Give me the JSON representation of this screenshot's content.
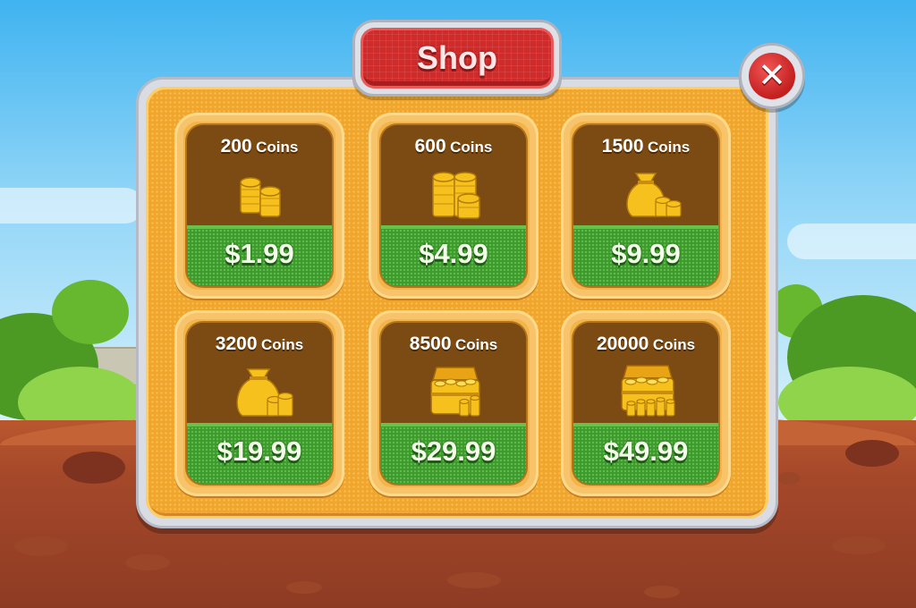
{
  "shop": {
    "title": "Shop",
    "close_icon": "close-x-icon",
    "items": [
      {
        "amount": "200",
        "unit": "Coins",
        "price": "$1.99",
        "icon": "coin-stack-small-icon"
      },
      {
        "amount": "600",
        "unit": "Coins",
        "price": "$4.99",
        "icon": "coin-stack-large-icon"
      },
      {
        "amount": "1500",
        "unit": "Coins",
        "price": "$9.99",
        "icon": "coin-bag-icon"
      },
      {
        "amount": "3200",
        "unit": "Coins",
        "price": "$19.99",
        "icon": "coin-bag-large-icon"
      },
      {
        "amount": "8500",
        "unit": "Coins",
        "price": "$29.99",
        "icon": "treasure-chest-icon"
      },
      {
        "amount": "20000",
        "unit": "Coins",
        "price": "$49.99",
        "icon": "treasure-chest-large-icon"
      }
    ]
  },
  "colors": {
    "panel": "#f0a52c",
    "title_red": "#cf2b2b",
    "price_green": "#3d9a2e",
    "card_brown": "#7c4b13",
    "gold": "#f7c51e"
  }
}
